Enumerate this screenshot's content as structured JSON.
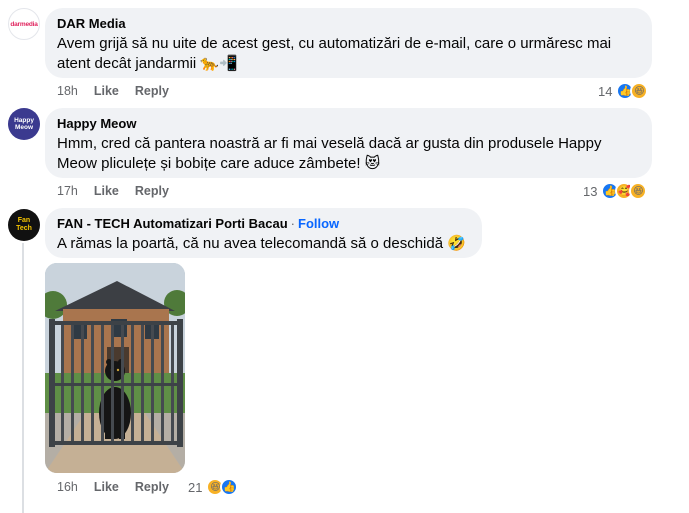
{
  "comments": [
    {
      "author": "DAR Media",
      "avatar_text": "darmedia",
      "text": "Avem grijă să nu uite de acest gest, cu automatizări de e-mail, care o urmăresc mai atent decât jandarmii 🐆📲",
      "time": "18h",
      "like": "Like",
      "reply": "Reply",
      "reaction_count": "14",
      "reactions": [
        "like-reaction-icon",
        "haha-reaction-icon"
      ]
    },
    {
      "author": "Happy Meow",
      "avatar_text": "Happy Meow",
      "text": "Hmm, cred că pantera noastră ar fi mai veselă dacă ar gusta din produsele Happy Meow pliculețe și bobițe care aduce zâmbete! 😻",
      "time": "17h",
      "like": "Like",
      "reply": "Reply",
      "reaction_count": "13",
      "reactions": [
        "like-reaction-icon",
        "care-reaction-icon",
        "haha-reaction-icon"
      ]
    },
    {
      "author": "FAN - TECH Automatizari Porti Bacau",
      "follow": "Follow",
      "avatar_text": "Fan Tech",
      "text": "A rămas la poartă, că nu avea telecomandă să o deschidă 🤣",
      "time": "16h",
      "like": "Like",
      "reply": "Reply",
      "reaction_count": "21",
      "reactions": [
        "haha-reaction-icon",
        "like-reaction-icon"
      ]
    }
  ],
  "colors": {
    "bubble": "#f0f2f5",
    "like_blue": "#1877f2",
    "follow_blue": "#0866ff",
    "meta_gray": "#65676b"
  }
}
